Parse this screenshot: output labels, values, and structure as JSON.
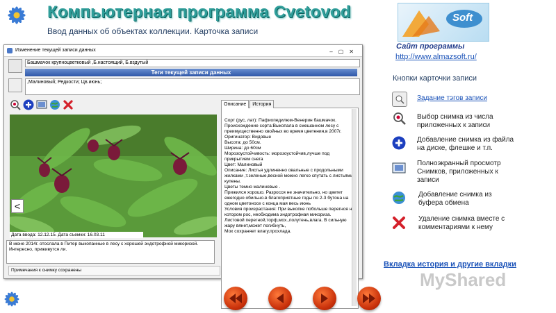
{
  "header": {
    "title": "Компьютерная программа Cvetovod",
    "subtitle": "Ввод данных об объектах коллекции. Карточка записи"
  },
  "window": {
    "title": "Изменение текущей записи данных",
    "record_name": "Башмачок крупноцветковый ,Б.настоящий, Б.вздутый",
    "tags_header": "Теги текущей записи данных",
    "tags_value": ",Малиновый; Редкости; Цв.июнь;",
    "tabs": [
      "Описание",
      "История"
    ],
    "description": "Сорт (рус, лат): Пафиопедилюм-Венерин башмачок.\nПроисхождение сорта:Выкопала в смешанном лесу с преимущественно хвойных во время цветения,в 2007г.\nОригинатор: Видовые\nВысота: до 50см.\nШирина: до 60см\nМорозоустойчивость: морозоустойчив,лучше под прикрытием снега\nЦвет: Малиновый\nОписание:  Листья удлиненно овальные с продольными жилками ,т.зеленые,весной можно легко спутать с листьями купены.\nЦветы темно малиновые .\n Прижился хорошо. Разросся не значительно, но цветет ежегодно обильно.в благоприятные годы по 2-3 бутона на одном цветоносе с конца мая весь июнь\nУсловия произрастания: При выкопке побольше перегноя на котором рос, необходима эндотрофная микориза.\nЛистовой перегной,торф,мох.,полутень,влага. В сильную жару вянет,может погибнуть,\n  Мох сохраняет влагу,прохлада.",
    "date_input": "Дата ввода: 12.12.15. Дата съемки: 16.03.11",
    "photo_note": "В июне  2014г. отослала в Питер выкопанные в лесу с хорошей эндотрофной микоризой. Интересно, приживутся ли.",
    "status": "Примечания к снимку сохранены",
    "prev_arrow": "<"
  },
  "right": {
    "site_label": "Сайт программы",
    "site_url": "http://www.almazsoft.ru/",
    "logo_text": "Soft",
    "section_title": "Кнопки карточки записи",
    "buttons": [
      {
        "icon": "tags-icon",
        "label": "Задание тэгов записи",
        "link": true
      },
      {
        "icon": "zoom-icon",
        "label": "Выбор снимка из числа приложенных к записи",
        "link": false
      },
      {
        "icon": "add-icon",
        "label": "Добавление снимка из файла на диске, флешке и т.п.",
        "link": false
      },
      {
        "icon": "fullscreen-icon",
        "label": "Полноэкранный просмотр Снимков, приложенных к записи",
        "link": false
      },
      {
        "icon": "clipboard-globe-icon",
        "label": "Добавление снимка из буфера обмена",
        "link": false
      },
      {
        "icon": "delete-icon",
        "label": "Удаление снимка вместе с комментариями к нему",
        "link": false
      }
    ],
    "history_link": "Вкладка история и другие вкладки"
  },
  "watermark": "MyShared",
  "colors": {
    "accent": "#2f9e9a",
    "link": "#1a52b8",
    "nav": "#d9420e"
  }
}
